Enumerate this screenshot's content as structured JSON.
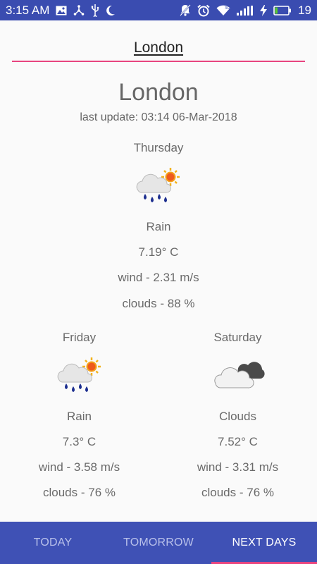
{
  "status_bar": {
    "time": "3:15 AM",
    "battery_level": "19",
    "left_icons": [
      "image-icon",
      "share-icon",
      "usb-icon",
      "moon-icon"
    ],
    "right_icons": [
      "mute-notifications-icon",
      "alarm-icon",
      "wifi-icon",
      "signal-icon",
      "charging-icon",
      "battery-icon"
    ]
  },
  "search": {
    "value": "London"
  },
  "location": {
    "city": "London",
    "last_update": "last update: 03:14 06-Mar-2018"
  },
  "today": {
    "day": "Thursday",
    "icon": "rain-sun-icon",
    "condition": "Rain",
    "temperature": "7.19° C",
    "wind": "wind - 2.31 m/s",
    "clouds": "clouds - 88 %"
  },
  "forecast": [
    {
      "day": "Friday",
      "icon": "rain-sun-icon",
      "condition": "Rain",
      "temperature": "7.3° C",
      "wind": "wind - 3.58 m/s",
      "clouds": "clouds - 76 %"
    },
    {
      "day": "Saturday",
      "icon": "clouds-icon",
      "condition": "Clouds",
      "temperature": "7.52° C",
      "wind": "wind - 3.31 m/s",
      "clouds": "clouds - 76 %"
    }
  ],
  "bottom_nav": {
    "tabs": [
      "TODAY",
      "TOMORROW",
      "NEXT DAYS"
    ],
    "active": "NEXT DAYS"
  },
  "colors": {
    "primary": "#3f51b5",
    "status_bar": "#3a4cb0",
    "accent": "#e8457f",
    "text": "#6a6a6a"
  }
}
